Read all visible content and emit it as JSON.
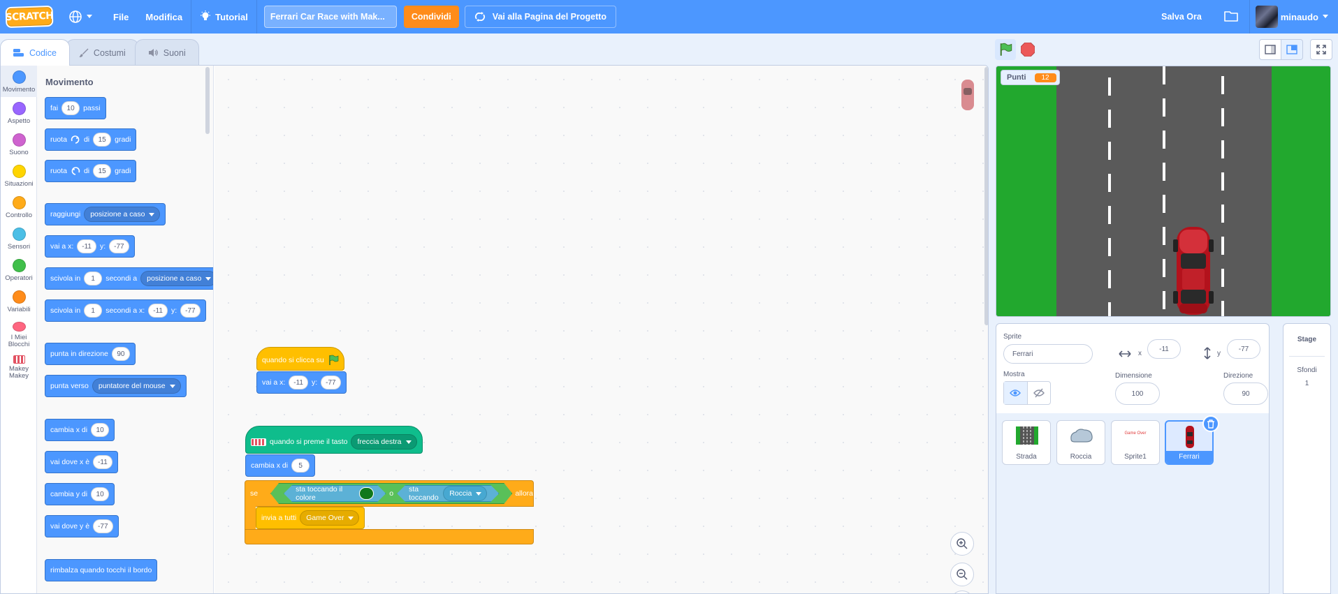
{
  "menubar": {
    "logo_text": "SCRATCH",
    "file": "File",
    "edit": "Modifica",
    "tutorial": "Tutorial",
    "project_title": "Ferrari Car Race with Mak...",
    "share": "Condividi",
    "see_project_page": "Vai alla Pagina del Progetto",
    "save_now": "Salva Ora",
    "username": "minaudo"
  },
  "tabs": {
    "code": "Codice",
    "costumes": "Costumi",
    "sounds": "Suoni"
  },
  "categories": [
    {
      "label": "Movimento",
      "color": "#4c97ff"
    },
    {
      "label": "Aspetto",
      "color": "#9966ff"
    },
    {
      "label": "Suono",
      "color": "#cf63cf"
    },
    {
      "label": "Situazioni",
      "color": "#ffd500"
    },
    {
      "label": "Controllo",
      "color": "#ffab19"
    },
    {
      "label": "Sensori",
      "color": "#4cbfe6"
    },
    {
      "label": "Operatori",
      "color": "#40bf4a"
    },
    {
      "label": "Variabili",
      "color": "#ff8c1a"
    },
    {
      "label": "I Miei Blocchi",
      "color": "#ff6680"
    },
    {
      "label": "Makey Makey",
      "color": "#e25262"
    }
  ],
  "palette": {
    "title": "Movimento",
    "move": {
      "a": "fai",
      "n": "10",
      "b": "passi"
    },
    "turn_right": {
      "a": "ruota",
      "b": "di",
      "n": "15",
      "c": "gradi"
    },
    "turn_left": {
      "a": "ruota",
      "b": "di",
      "n": "15",
      "c": "gradi"
    },
    "goto": {
      "a": "raggiungi",
      "opt": "posizione a caso"
    },
    "goto_xy": {
      "a": "vai a x:",
      "x": "-11",
      "b": "y:",
      "y": "-77"
    },
    "glide_to": {
      "a": "scivola in",
      "n": "1",
      "b": "secondi a",
      "opt": "posizione a caso"
    },
    "glide_xy": {
      "a": "scivola in",
      "n": "1",
      "b": "secondi a x:",
      "x": "-11",
      "c": "y:",
      "y": "-77"
    },
    "point_dir": {
      "a": "punta in direzione",
      "n": "90"
    },
    "point_towards": {
      "a": "punta verso",
      "opt": "puntatore del mouse"
    },
    "change_x": {
      "a": "cambia x di",
      "n": "10"
    },
    "set_x": {
      "a": "vai dove x è",
      "n": "-11"
    },
    "change_y": {
      "a": "cambia y di",
      "n": "10"
    },
    "set_y": {
      "a": "vai dove y è",
      "n": "-77"
    },
    "bounce": "rimbalza quando tocchi il bordo"
  },
  "script1": {
    "hat": "quando si clicca su",
    "goto": {
      "a": "vai a x:",
      "x": "-11",
      "b": "y:",
      "y": "-77"
    }
  },
  "script2": {
    "hat": "quando si preme il tasto",
    "key": "freccia destra",
    "change_x": {
      "a": "cambia x di",
      "n": "5"
    },
    "if_label": "se",
    "touch_color": "sta toccando il colore",
    "or": "o",
    "touching": "sta toccando",
    "touch_target": "Roccia",
    "then": "allora",
    "broadcast": "invia a tutti",
    "message": "Game Over"
  },
  "stage": {
    "monitor_label": "Punti",
    "monitor_value": "12"
  },
  "sprite_info": {
    "sprite_label": "Sprite",
    "sprite_name": "Ferrari",
    "x_label": "x",
    "x_value": "-11",
    "y_label": "y",
    "y_value": "-77",
    "show_label": "Mostra",
    "size_label": "Dimensione",
    "size_value": "100",
    "direction_label": "Direzione",
    "direction_value": "90"
  },
  "sprites": [
    {
      "name": "Strada"
    },
    {
      "name": "Roccia"
    },
    {
      "name": "Sprite1",
      "thumb_text": "Game Over"
    },
    {
      "name": "Ferrari",
      "selected": true
    }
  ],
  "stage_panel": {
    "title": "Stage",
    "backdrops_label": "Sfondi",
    "backdrops_count": "1"
  }
}
